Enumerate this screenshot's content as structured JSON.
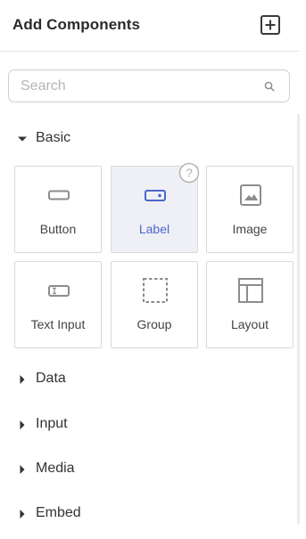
{
  "header": {
    "title": "Add Components",
    "add_icon": "plus-square-icon"
  },
  "search": {
    "placeholder": "Search",
    "value": "",
    "icon": "search-icon"
  },
  "sections": {
    "basic": {
      "label": "Basic",
      "expanded": true,
      "components": [
        {
          "label": "Button",
          "icon": "button-icon"
        },
        {
          "label": "Label",
          "icon": "label-icon",
          "selected": true
        },
        {
          "label": "Image",
          "icon": "image-icon"
        },
        {
          "label": "Text Input",
          "icon": "text-input-icon"
        },
        {
          "label": "Group",
          "icon": "group-icon"
        },
        {
          "label": "Layout",
          "icon": "layout-icon"
        }
      ]
    },
    "data": {
      "label": "Data",
      "expanded": false
    },
    "input": {
      "label": "Input",
      "expanded": false
    },
    "media": {
      "label": "Media",
      "expanded": false
    },
    "embed": {
      "label": "Embed",
      "expanded": false
    }
  },
  "help": {
    "glyph": "?",
    "icon": "help-icon"
  },
  "colors": {
    "accent": "#4d66c9",
    "icon_gray": "#8c8c8c",
    "selected_bg": "#eef0f5",
    "border": "#d9d9d9"
  }
}
